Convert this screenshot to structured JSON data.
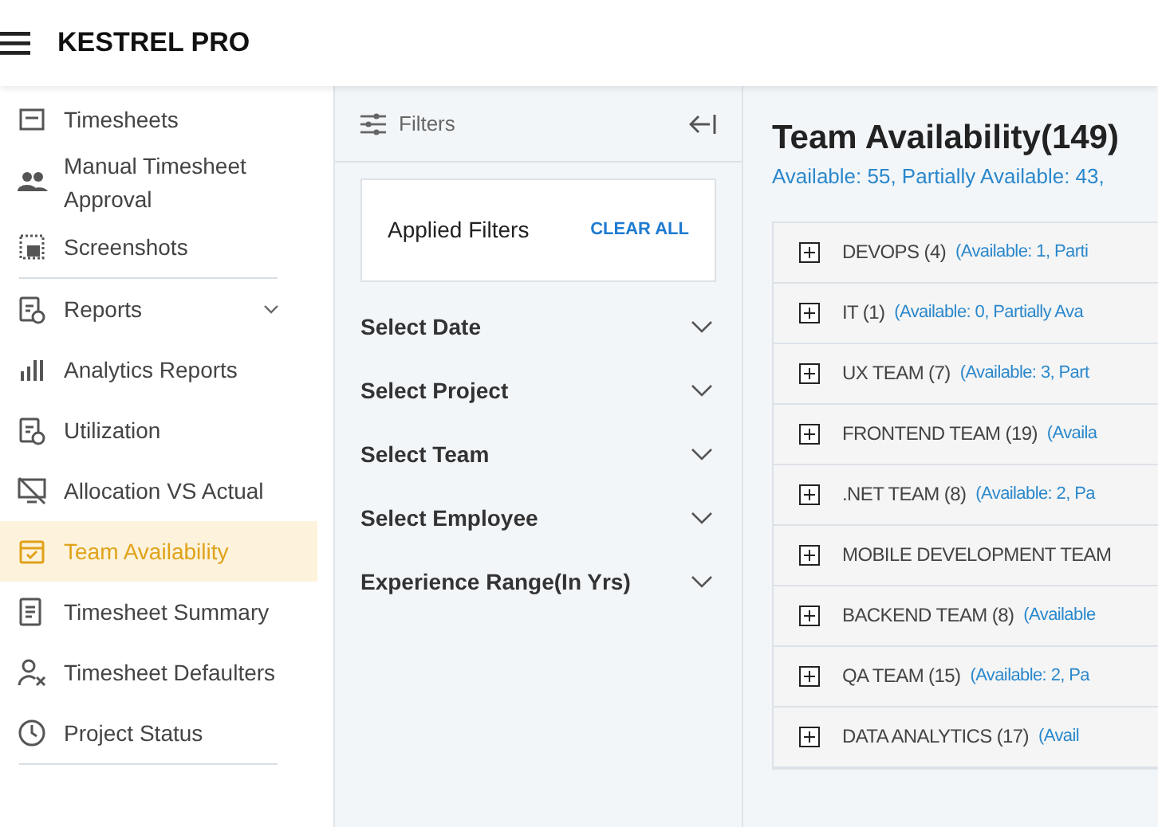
{
  "header": {
    "title": "KESTREL PRO"
  },
  "sidebar": {
    "items": [
      {
        "label": "Timesheets",
        "selected": false
      },
      {
        "label": "Manual Timesheet Approval",
        "selected": false
      },
      {
        "label": "Screenshots",
        "selected": false
      },
      {
        "label": "Reports",
        "selected": false,
        "expanded": false
      },
      {
        "label": "Analytics Reports",
        "selected": false
      },
      {
        "label": "Utilization",
        "selected": false
      },
      {
        "label": "Allocation VS Actual",
        "selected": false
      },
      {
        "label": "Team Availability",
        "selected": true
      },
      {
        "label": "Timesheet Summary",
        "selected": false
      },
      {
        "label": "Timesheet Defaulters",
        "selected": false
      },
      {
        "label": "Project Status",
        "selected": false
      }
    ]
  },
  "filters": {
    "title": "Filters",
    "applied_title": "Applied Filters",
    "clear_all": "CLEAR ALL",
    "dropdowns": [
      {
        "label": "Select Date",
        "expanded": false
      },
      {
        "label": "Select Project",
        "expanded": false
      },
      {
        "label": "Select Team",
        "expanded": false
      },
      {
        "label": "Select Employee",
        "expanded": false
      },
      {
        "label": "Experience Range(In Yrs)",
        "expanded": false
      }
    ]
  },
  "main": {
    "title": "Team Availability(149)",
    "summary": "Available: 55, Partially Available: 43,",
    "teams": [
      {
        "name": "DEVOPS (4)",
        "availability": "(Available: 1, Parti",
        "expanded": false
      },
      {
        "name": "IT (1)",
        "availability": "(Available: 0, Partially Ava",
        "expanded": false
      },
      {
        "name": "UX TEAM (7)",
        "availability": "(Available: 3, Part",
        "expanded": false
      },
      {
        "name": "FRONTEND TEAM (19)",
        "availability": "(Availa",
        "expanded": false
      },
      {
        "name": ".NET TEAM (8)",
        "availability": "(Available: 2, Pa",
        "expanded": false
      },
      {
        "name": "MOBILE DEVELOPMENT TEAM",
        "expanded": false
      },
      {
        "name": "BACKEND TEAM (8)",
        "availability": "(Available",
        "expanded": false
      },
      {
        "name": "QA TEAM (15)",
        "availability": "(Available: 2, Pa",
        "expanded": false
      },
      {
        "name": "DATA ANALYTICS (17)",
        "availability": "(Avail",
        "expanded": false
      }
    ]
  }
}
